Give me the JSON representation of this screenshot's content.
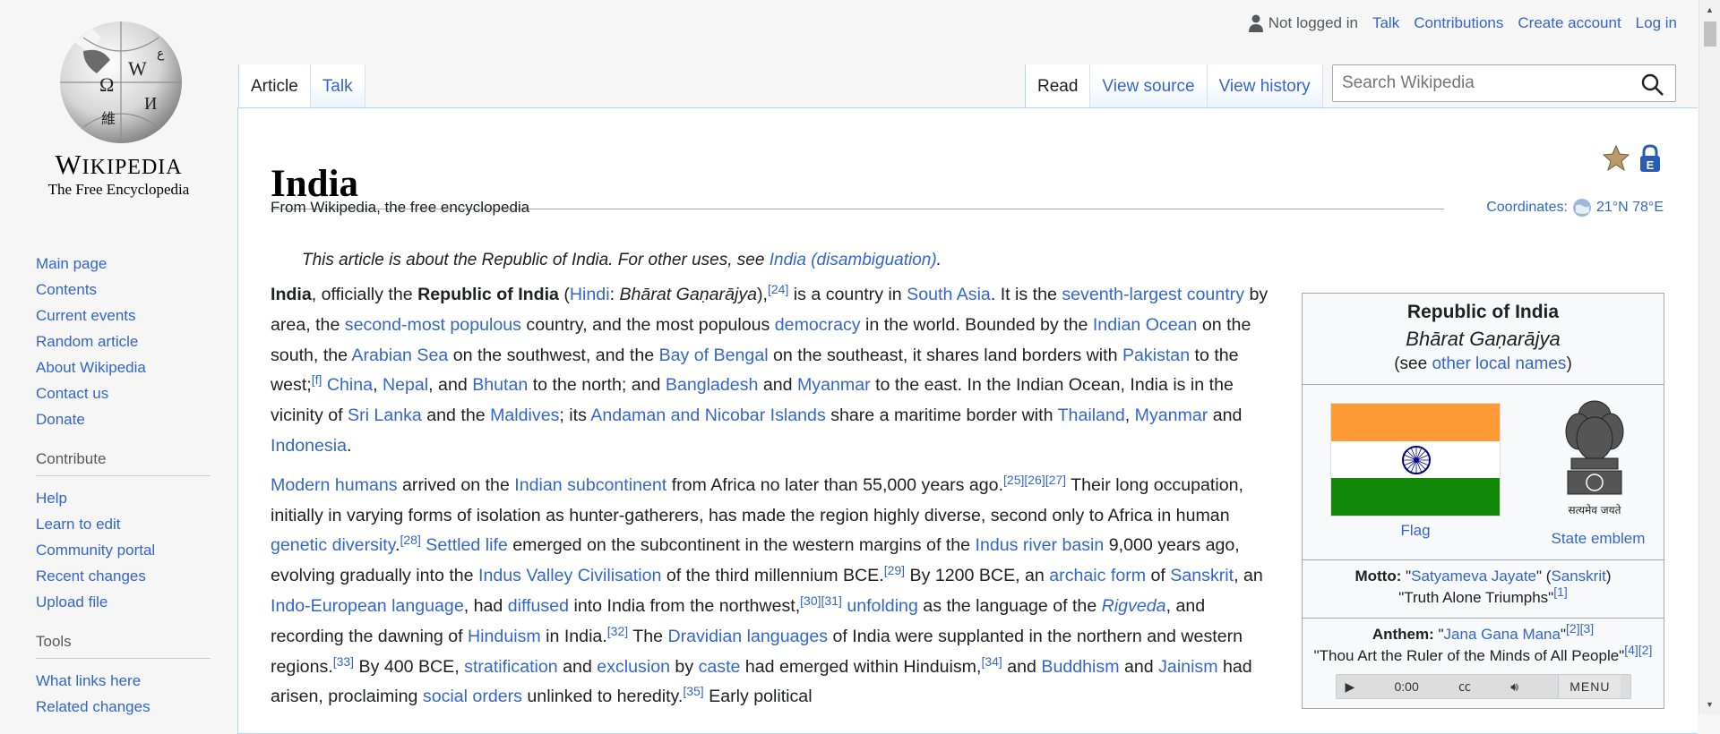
{
  "logo": {
    "wordmark_first": "W",
    "wordmark_small": "IKIPEDIA",
    "tagline": "The Free Encyclopedia"
  },
  "sidebar": {
    "nav": [
      {
        "label": "Main page"
      },
      {
        "label": "Contents"
      },
      {
        "label": "Current events"
      },
      {
        "label": "Random article"
      },
      {
        "label": "About Wikipedia"
      },
      {
        "label": "Contact us"
      },
      {
        "label": "Donate"
      }
    ],
    "contribute_heading": "Contribute",
    "contribute": [
      {
        "label": "Help"
      },
      {
        "label": "Learn to edit"
      },
      {
        "label": "Community portal"
      },
      {
        "label": "Recent changes"
      },
      {
        "label": "Upload file"
      }
    ],
    "tools_heading": "Tools",
    "tools": [
      {
        "label": "What links here"
      },
      {
        "label": "Related changes"
      }
    ]
  },
  "personal": {
    "status": "Not logged in",
    "talk": "Talk",
    "contributions": "Contributions",
    "create_account": "Create account",
    "login": "Log in"
  },
  "tabs": {
    "article": "Article",
    "talk": "Talk",
    "read": "Read",
    "view_source": "View source",
    "view_history": "View history"
  },
  "search": {
    "placeholder": "Search Wikipedia"
  },
  "article": {
    "title": "India",
    "tagline": "From Wikipedia, the free encyclopedia",
    "coords_label": "Coordinates:",
    "coords_value": "21°N 78°E",
    "hatnote_text": "This article is about the Republic of India. For other uses, see ",
    "hatnote_link": "India (disambiguation)",
    "hatnote_end": "."
  },
  "infobox": {
    "name": "Republic of India",
    "native": "Bhārat Gaṇarājya",
    "local_pre": "(see ",
    "local_link": "other local names",
    "local_post": ")",
    "flag_caption": "Flag",
    "emblem_caption": "State emblem",
    "emblem_text": "सत्यमेव जयते",
    "motto_label": "Motto:",
    "motto_value": "Satyameva Jayate",
    "motto_lang": "Sanskrit",
    "motto_translation": "\"Truth Alone Triumphs\"",
    "motto_ref": "[1]",
    "anthem_label": "Anthem:",
    "anthem_value": "Jana Gana Mana",
    "anthem_refs": "[2][3]",
    "anthem_translation": "\"Thou Art the Ruler of the Minds of All People\"",
    "anthem_trans_refs": "[4][2]",
    "player_time": "0:00",
    "player_menu": "MENU",
    "flag_colors": [
      "#ff9933",
      "#ffffff",
      "#138808"
    ],
    "chakra_color": "#000080"
  }
}
